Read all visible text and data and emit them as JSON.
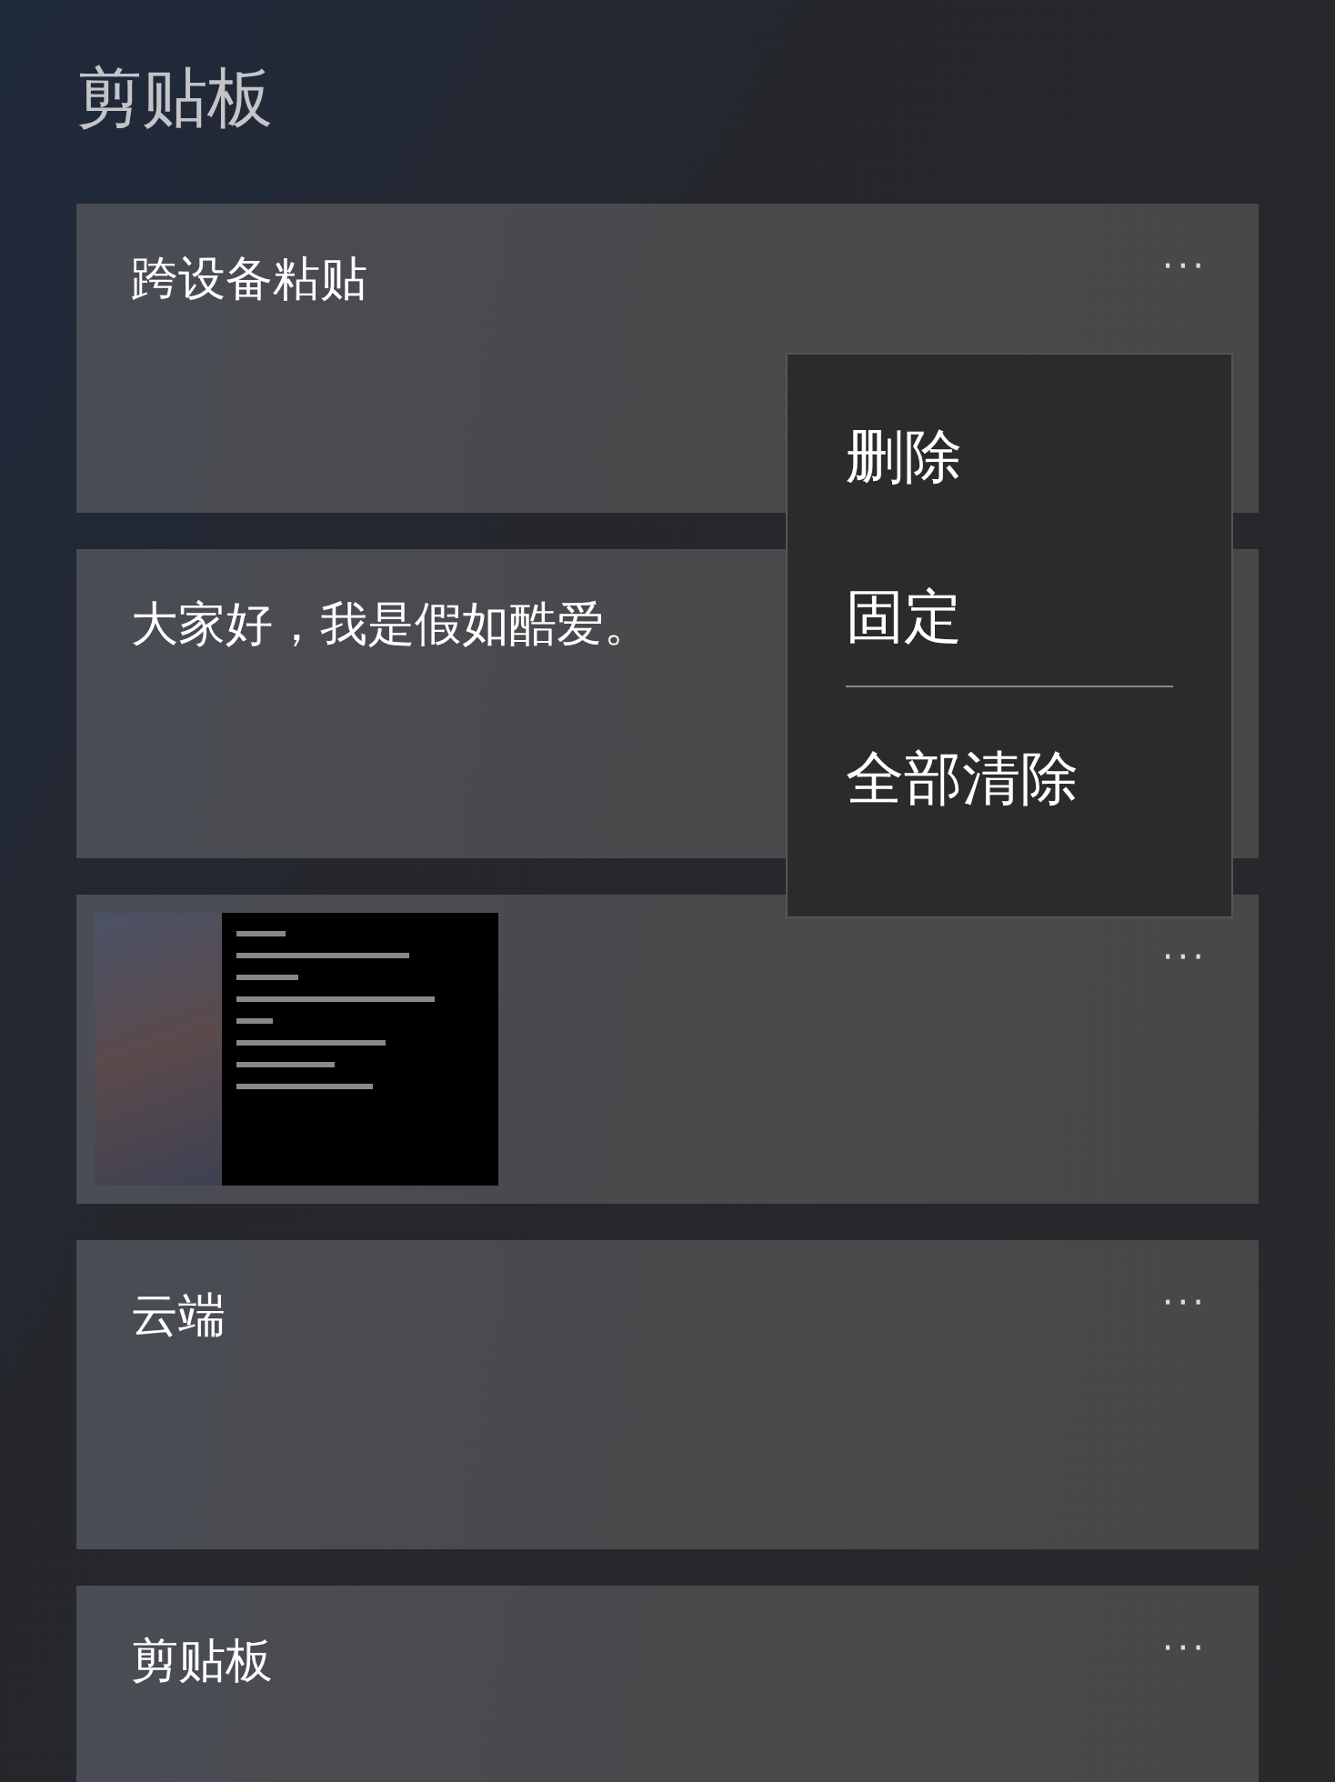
{
  "title": "剪贴板",
  "items": [
    {
      "kind": "text",
      "text": "跨设备粘贴",
      "more_label": "···"
    },
    {
      "kind": "text",
      "text": "大家好，我是假如酷爱。"
    },
    {
      "kind": "image",
      "more_label": "···"
    },
    {
      "kind": "text",
      "text": "云端",
      "more_label": "···"
    },
    {
      "kind": "text",
      "text": "剪贴板",
      "more_label": "···"
    }
  ],
  "menu": {
    "groups": [
      [
        "删除",
        "固定"
      ],
      [
        "全部清除"
      ]
    ]
  }
}
